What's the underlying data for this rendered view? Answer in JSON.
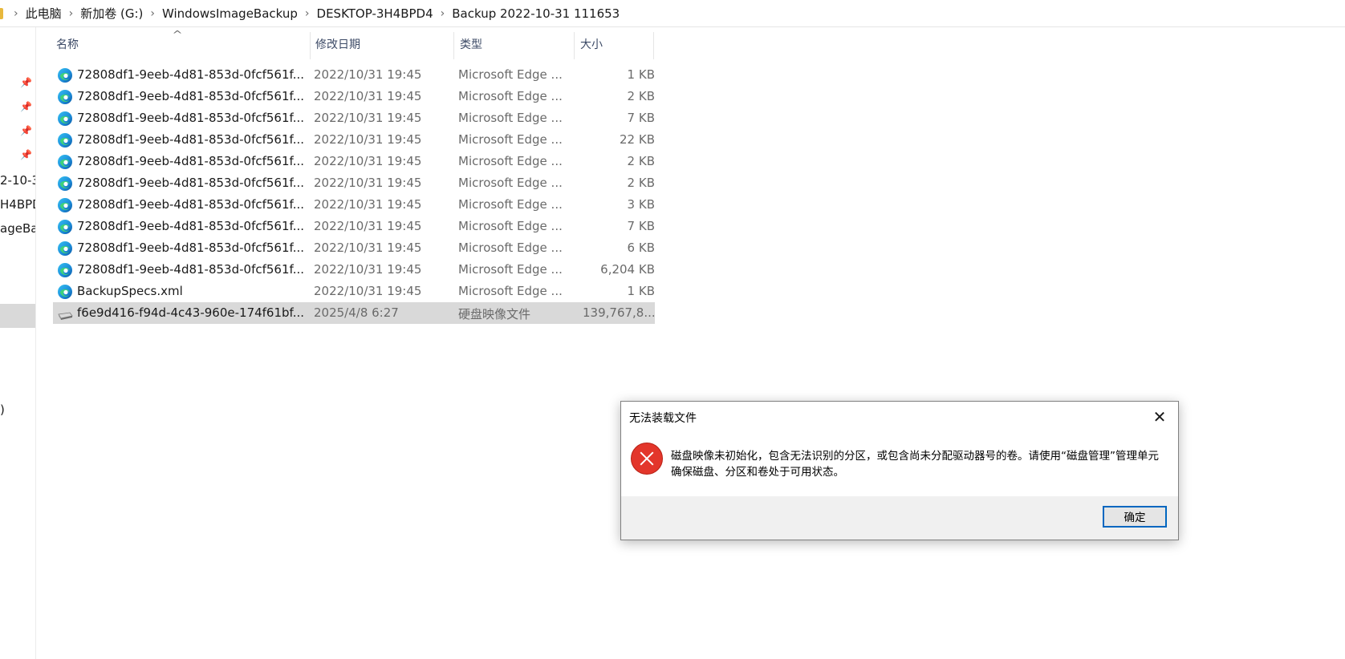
{
  "breadcrumb": [
    "此电脑",
    "新加卷 (G:)",
    "WindowsImageBackup",
    "DESKTOP-3H4BPD4",
    "Backup 2022-10-31 111653"
  ],
  "nav": {
    "partial_items": [
      "2-10-3",
      "H4BPD",
      "ageBa",
      ")"
    ]
  },
  "columns": {
    "name": "名称",
    "date": "修改日期",
    "type": "类型",
    "size": "大小"
  },
  "files": [
    {
      "name": "72808df1-9eeb-4d81-853d-0fcf561f...",
      "date": "2022/10/31 19:45",
      "type": "Microsoft Edge ...",
      "size": "1 KB",
      "icon": "edge-icon"
    },
    {
      "name": "72808df1-9eeb-4d81-853d-0fcf561f...",
      "date": "2022/10/31 19:45",
      "type": "Microsoft Edge ...",
      "size": "2 KB",
      "icon": "edge-icon"
    },
    {
      "name": "72808df1-9eeb-4d81-853d-0fcf561f...",
      "date": "2022/10/31 19:45",
      "type": "Microsoft Edge ...",
      "size": "7 KB",
      "icon": "edge-icon"
    },
    {
      "name": "72808df1-9eeb-4d81-853d-0fcf561f...",
      "date": "2022/10/31 19:45",
      "type": "Microsoft Edge ...",
      "size": "22 KB",
      "icon": "edge-icon"
    },
    {
      "name": "72808df1-9eeb-4d81-853d-0fcf561f...",
      "date": "2022/10/31 19:45",
      "type": "Microsoft Edge ...",
      "size": "2 KB",
      "icon": "edge-icon"
    },
    {
      "name": "72808df1-9eeb-4d81-853d-0fcf561f...",
      "date": "2022/10/31 19:45",
      "type": "Microsoft Edge ...",
      "size": "2 KB",
      "icon": "edge-icon"
    },
    {
      "name": "72808df1-9eeb-4d81-853d-0fcf561f...",
      "date": "2022/10/31 19:45",
      "type": "Microsoft Edge ...",
      "size": "3 KB",
      "icon": "edge-icon"
    },
    {
      "name": "72808df1-9eeb-4d81-853d-0fcf561f...",
      "date": "2022/10/31 19:45",
      "type": "Microsoft Edge ...",
      "size": "7 KB",
      "icon": "edge-icon"
    },
    {
      "name": "72808df1-9eeb-4d81-853d-0fcf561f...",
      "date": "2022/10/31 19:45",
      "type": "Microsoft Edge ...",
      "size": "6 KB",
      "icon": "edge-icon"
    },
    {
      "name": "72808df1-9eeb-4d81-853d-0fcf561f...",
      "date": "2022/10/31 19:45",
      "type": "Microsoft Edge ...",
      "size": "6,204 KB",
      "icon": "edge-icon"
    },
    {
      "name": "BackupSpecs.xml",
      "date": "2022/10/31 19:45",
      "type": "Microsoft Edge ...",
      "size": "1 KB",
      "icon": "edge-icon"
    },
    {
      "name": "f6e9d416-f94d-4c43-960e-174f61bf...",
      "date": "2025/4/8 6:27",
      "type": "硬盘映像文件",
      "size": "139,767,8...",
      "icon": "disk-icon",
      "selected": true
    }
  ],
  "dialog": {
    "title": "无法装载文件",
    "message": "磁盘映像未初始化，包含无法识别的分区，或包含尚未分配驱动器号的卷。请使用“磁盘管理”管理单元确保磁盘、分区和卷处于可用状态。",
    "ok_label": "确定",
    "close_glyph": "✕"
  },
  "colors": {
    "accent": "#0067c0",
    "error": "#e3362b",
    "selection": "#d9d9d9"
  }
}
